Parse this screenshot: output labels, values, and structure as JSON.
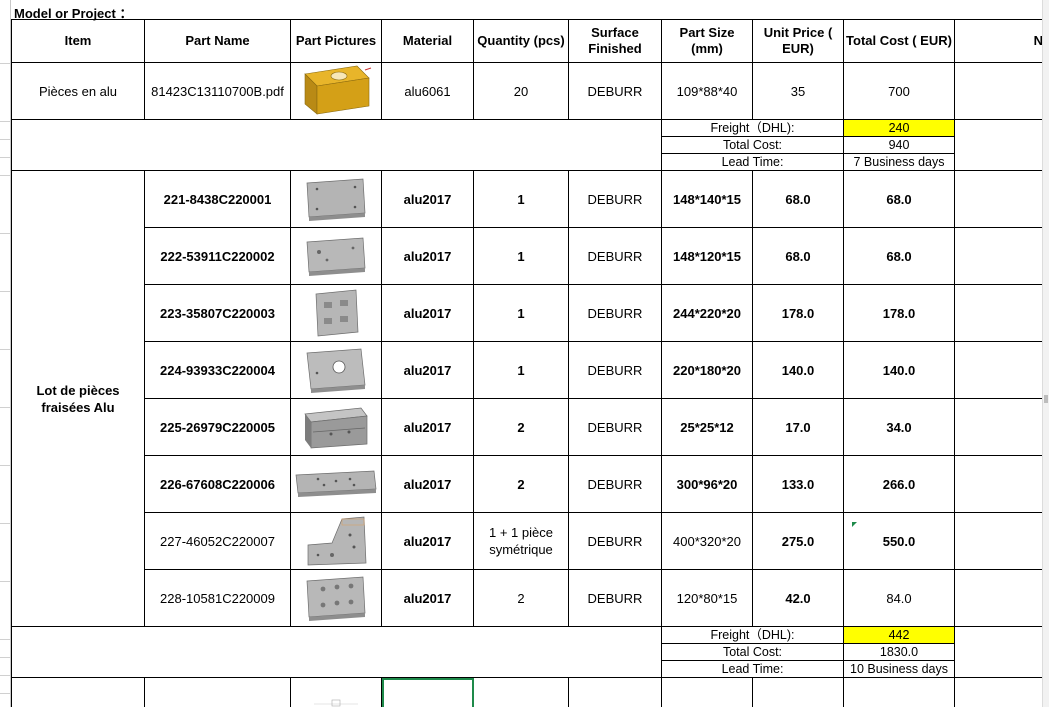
{
  "sheet": {
    "title": "Model or Project ：",
    "headers": [
      "Item",
      "Part Name",
      "Part Pictures",
      "Material",
      "Quantity (pcs)",
      "Surface Finished",
      "Part Size (mm)",
      "Unit Price ( EUR)",
      "Total Cost ( EUR)",
      "No"
    ]
  },
  "block1": {
    "item": "Pièces en alu",
    "row": {
      "part_name": "81423C13110700B.pdf",
      "material": "alu6061",
      "quantity": "20",
      "surface": "DEBURR",
      "size": "109*88*40",
      "unit_price": "35",
      "total": "700"
    },
    "summary": [
      {
        "label": "Freight（DHL):",
        "value": "240"
      },
      {
        "label": "Total Cost:",
        "value": "940"
      },
      {
        "label": "Lead Time:",
        "value": "7 Business days"
      }
    ]
  },
  "block2": {
    "item": "Lot de pièces fraisées Alu",
    "rows": [
      {
        "part_name": "221-8438C220001",
        "material": "alu2017",
        "quantity": "1",
        "surface": "DEBURR",
        "size": "148*140*15",
        "unit_price": "68.0",
        "total": "68.0"
      },
      {
        "part_name": "222-53911C220002",
        "material": "alu2017",
        "quantity": "1",
        "surface": "DEBURR",
        "size": "148*120*15",
        "unit_price": "68.0",
        "total": "68.0"
      },
      {
        "part_name": "223-35807C220003",
        "material": "alu2017",
        "quantity": "1",
        "surface": "DEBURR",
        "size": "244*220*20",
        "unit_price": "178.0",
        "total": "178.0"
      },
      {
        "part_name": "224-93933C220004",
        "material": "alu2017",
        "quantity": "1",
        "surface": "DEBURR",
        "size": "220*180*20",
        "unit_price": "140.0",
        "total": "140.0"
      },
      {
        "part_name": "225-26979C220005",
        "material": "alu2017",
        "quantity": "2",
        "surface": "DEBURR",
        "size": "25*25*12",
        "unit_price": "17.0",
        "total": "34.0"
      },
      {
        "part_name": "226-67608C220006",
        "material": "alu2017",
        "quantity": "2",
        "surface": "DEBURR",
        "size": "300*96*20",
        "unit_price": "133.0",
        "total": "266.0"
      },
      {
        "part_name": "227-46052C220007",
        "material": "alu2017",
        "quantity": "1 + 1 pièce symétrique",
        "surface": "DEBURR",
        "size": "400*320*20",
        "unit_price": "275.0",
        "total": "550.0"
      },
      {
        "part_name": "228-10581C220009",
        "material": "alu2017",
        "quantity": "2",
        "surface": "DEBURR",
        "size": "120*80*15",
        "unit_price": "42.0",
        "total": "84.0"
      }
    ],
    "summary": [
      {
        "label": "Freight（DHL):",
        "value": "442"
      },
      {
        "label": "Total Cost:",
        "value": "1830.0"
      },
      {
        "label": "Lead Time:",
        "value": "10 Business days"
      }
    ]
  },
  "colors": {
    "highlight": "#ffff00",
    "selection": "#1e8a4a",
    "gold_part": "#d4a017",
    "grey_part": "#a8a8a8"
  }
}
